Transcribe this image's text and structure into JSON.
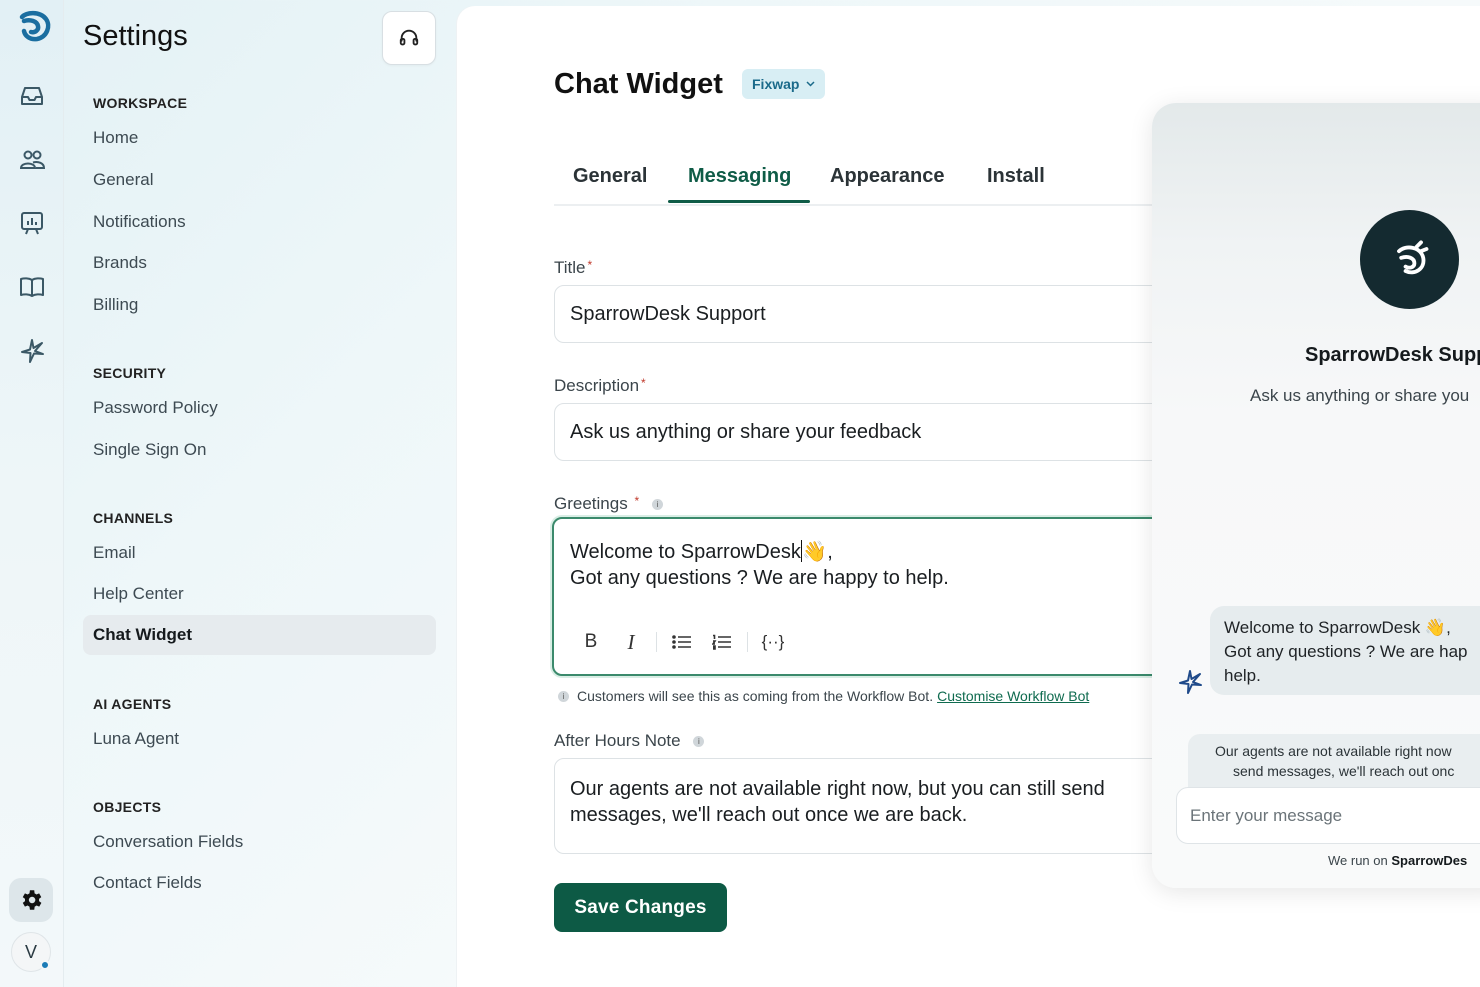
{
  "sidebar": {
    "title": "Settings",
    "sections": [
      {
        "heading": "WORKSPACE",
        "items": [
          "Home",
          "General",
          "Notifications",
          "Brands",
          "Billing"
        ]
      },
      {
        "heading": "SECURITY",
        "items": [
          "Password Policy",
          "Single Sign On"
        ]
      },
      {
        "heading": "CHANNELS",
        "items": [
          "Email",
          "Help Center",
          "Chat Widget"
        ]
      },
      {
        "heading": "AI AGENTS",
        "items": [
          "Luna Agent"
        ]
      },
      {
        "heading": "OBJECTS",
        "items": [
          "Conversation Fields",
          "Contact Fields"
        ]
      }
    ],
    "active_item": "Chat Widget"
  },
  "rail": {
    "icons": [
      "logo-icon",
      "inbox-icon",
      "contacts-icon",
      "reports-icon",
      "knowledge-base-icon",
      "ai-agent-icon",
      "settings-gear-icon"
    ],
    "avatar_initial": "V"
  },
  "main": {
    "title": "Chat Widget",
    "brand_selector": "Fixwap",
    "tabs": [
      "General",
      "Messaging",
      "Appearance",
      "Install"
    ],
    "active_tab": "Messaging",
    "fields": {
      "title": {
        "label": "Title",
        "required_mark": "*",
        "value": "SparrowDesk Support"
      },
      "description": {
        "label": "Description",
        "required_mark": "*",
        "value": "Ask us anything or share your feedback"
      },
      "greetings": {
        "label": "Greetings",
        "required_mark": "*",
        "line1": "Welcome to SparrowDesk",
        "emoji": "👋",
        "line1_suffix": ",",
        "line2": "Got any questions ? We are happy to help."
      },
      "greetings_hint": "Customers will see this as coming from the Workflow Bot.",
      "greetings_hint_link": "Customise Workflow Bot",
      "after_hours": {
        "label": "After Hours Note",
        "value": "Our agents are not available right now, but you can still send messages, we'll reach out once we are back."
      }
    },
    "toolbar": [
      "bold-icon",
      "italic-icon",
      "bullet-list-icon",
      "numbered-list-icon",
      "variable-icon"
    ],
    "save_label": "Save Changes"
  },
  "preview": {
    "title": "SparrowDesk Supp",
    "description": "Ask us anything or share you",
    "bubble_line1": "Welcome to SparrowDesk 👋,",
    "bubble_line2": "Got any questions ? We are hap",
    "bubble_line3": "help.",
    "offline_line1": "Our agents are not available right now",
    "offline_line2": "send messages, we'll reach out onc",
    "input_placeholder": "Enter your message",
    "footer_prefix": "We run on",
    "footer_brand": "SparrowDes"
  },
  "colors": {
    "primary": "#0d5a45",
    "tab_active": "#0f5c47",
    "brand_chip_bg": "#d8eef4",
    "brand_chip_text": "#1a6a8a",
    "widget_avatar": "#142a30"
  }
}
